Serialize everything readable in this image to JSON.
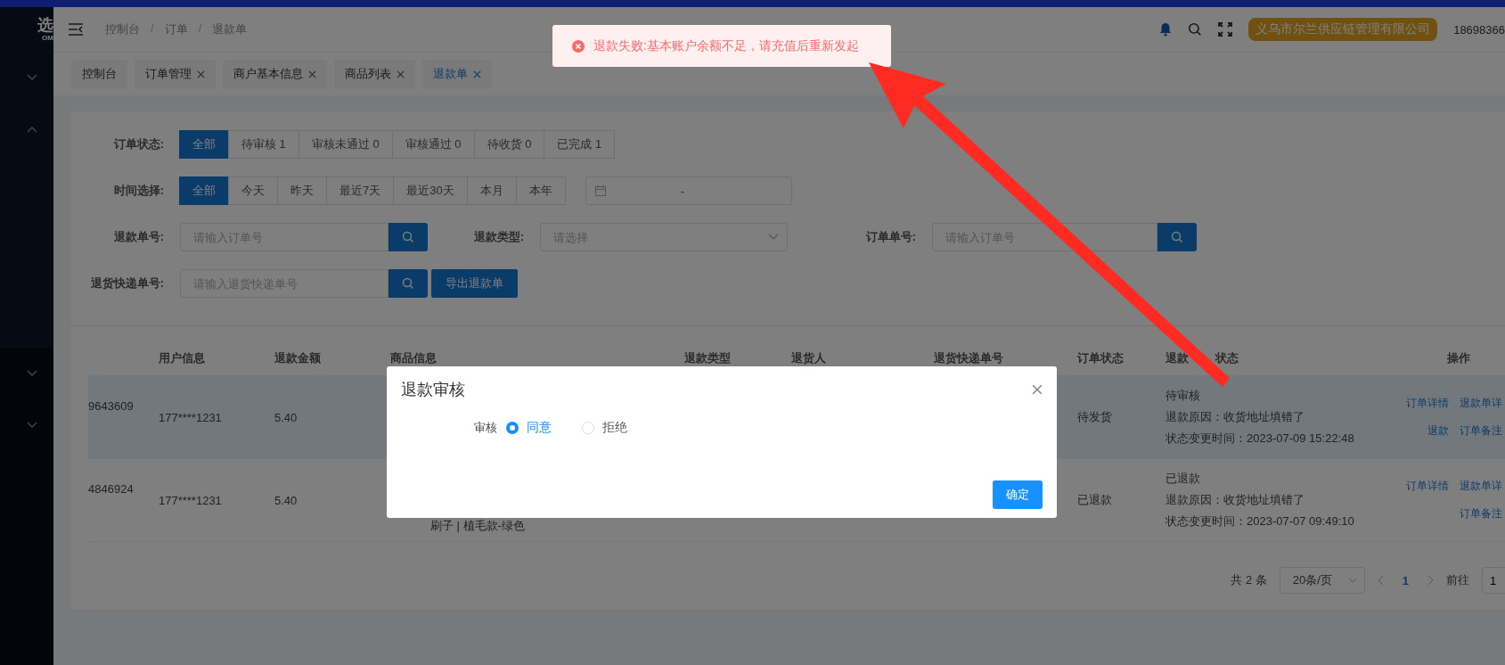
{
  "sidebar": {
    "logo_text": "选",
    "logo_subtext": "OM",
    "menus": [
      {
        "expanded": false
      },
      {
        "expanded": true
      },
      {
        "expanded": false
      },
      {
        "expanded": false
      }
    ]
  },
  "header": {
    "breadcrumb": [
      {
        "kind": "link",
        "text": "控制台"
      },
      {
        "kind": "separator",
        "text": "/"
      },
      {
        "kind": "link",
        "text": "订单"
      },
      {
        "kind": "separator",
        "text": "/"
      },
      {
        "kind": "link",
        "text": "退款单"
      }
    ],
    "company": "义乌市尔兰供应链管理有限公司",
    "user": "18698366"
  },
  "tabs": [
    {
      "label": "控制台",
      "closable": false,
      "selected": false
    },
    {
      "label": "订单管理",
      "closable": true,
      "selected": false
    },
    {
      "label": "商户基本信息",
      "closable": true,
      "selected": false
    },
    {
      "label": "商品列表",
      "closable": true,
      "selected": false
    },
    {
      "label": "退款单",
      "closable": true,
      "selected": true
    }
  ],
  "filters": {
    "order_status": {
      "label": "订单状态:",
      "options": [
        {
          "label": "全部",
          "selected": true
        },
        {
          "label": "待审核 1",
          "selected": false
        },
        {
          "label": "审核未通过 0",
          "selected": false
        },
        {
          "label": "审核通过 0",
          "selected": false
        },
        {
          "label": "待收货 0",
          "selected": false
        },
        {
          "label": "已完成 1",
          "selected": false
        }
      ]
    },
    "time": {
      "label": "时间选择:",
      "options": [
        {
          "label": "全部",
          "selected": true
        },
        {
          "label": "今天",
          "selected": false
        },
        {
          "label": "昨天",
          "selected": false
        },
        {
          "label": "最近7天",
          "selected": false
        },
        {
          "label": "最近30天",
          "selected": false
        },
        {
          "label": "本月",
          "selected": false
        },
        {
          "label": "本年",
          "selected": false
        }
      ],
      "range_separator": "-"
    },
    "refund_no": {
      "label": "退款单号:",
      "placeholder": "请输入订单号"
    },
    "refund_type": {
      "label": "退款类型:",
      "placeholder": "请选择"
    },
    "order_no": {
      "label": "订单单号:",
      "placeholder": "请输入订单号"
    },
    "express_no": {
      "label": "退货快递单号:",
      "placeholder": "请输入退货快递单号"
    },
    "export_button": "导出退款单"
  },
  "table": {
    "columns": [
      "用户信息",
      "退款金额",
      "商品信息",
      "退款类型",
      "退货人",
      "退货快递单号",
      "订单状态",
      [
        "退款",
        "状态"
      ],
      "操作"
    ],
    "rows": [
      {
        "selected": true,
        "order_no": "9643609",
        "user": "177****1231",
        "amount": "5.40",
        "order_status": "待发货",
        "refund_status": "待审核",
        "reason": "退款原因：收货地址填错了",
        "changed": "状态变更时间：2023-07-09 15:22:48",
        "actions": [
          "订单详情",
          "退款单详",
          "退款",
          "订单备注"
        ]
      },
      {
        "selected": false,
        "order_no": "4846924",
        "user": "177****1231",
        "amount": "5.40",
        "product": "刷子 | 植毛款-绿色",
        "order_status": "已退款",
        "refund_status": "已退款",
        "reason": "退款原因：收货地址填错了",
        "changed": "状态变更时间：2023-07-07 09:49:10",
        "actions": [
          "订单详情",
          "退款单详",
          "订单备注"
        ]
      }
    ]
  },
  "pagination": {
    "total": "共 2 条",
    "page_size": "20条/页",
    "pages": [
      {
        "label": "1",
        "selected": true
      }
    ],
    "goto_label": "前往",
    "goto_value": "1"
  },
  "dialog": {
    "title": "退款审核",
    "field_label": "审核",
    "options": [
      {
        "label": "同意",
        "selected": true
      },
      {
        "label": "拒绝",
        "selected": false
      }
    ],
    "confirm": "确定"
  },
  "toast": {
    "kind": "error",
    "message": "退款失败:基本账户余额不足，请充值后重新发起"
  }
}
